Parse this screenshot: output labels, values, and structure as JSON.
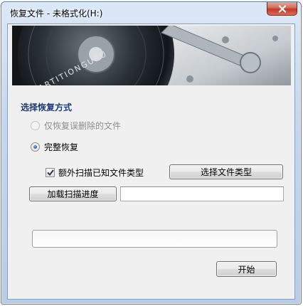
{
  "window": {
    "title": "恢复文件 - 未格式化(H:)",
    "close_icon": "close-icon"
  },
  "banner": {
    "brand_text": "PARTITIONGURU"
  },
  "recovery": {
    "section_title": "选择恢复方式",
    "option_deleted_only": "仅恢复误删除的文件",
    "option_deleted_only_enabled": false,
    "option_full": "完整恢复",
    "selected_option": "full",
    "extra_scan_label": "额外扫描已知文件类型",
    "extra_scan_checked": true,
    "select_types_button": "选择文件类型",
    "load_progress_button": "加载扫描进度",
    "progress_path_value": "",
    "progress_value": 0,
    "start_button": "开始"
  }
}
